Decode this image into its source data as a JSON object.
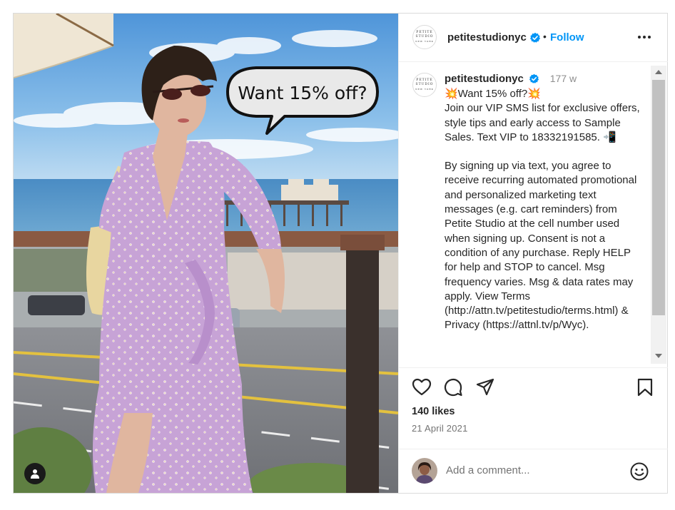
{
  "photo": {
    "bubble_text": "Want 15% off?",
    "user_tag_icon": "user-icon"
  },
  "header": {
    "avatar_lines": [
      "PETITE",
      "STUDIO",
      "NEW YORK"
    ],
    "username": "petitestudionyc",
    "verified_icon": "verified-badge-icon",
    "separator": "•",
    "follow_label": "Follow",
    "more_icon": "more-options-icon"
  },
  "caption": {
    "username": "petitestudionyc",
    "age": "177 w",
    "paragraph1": "💥Want 15% off?💥\nJoin our VIP SMS list for exclusive offers, style tips and early access to Sample Sales. Text VIP to 18332191585. 📲",
    "paragraph2": "By signing up via text, you agree to receive recurring automated promotional and personalized marketing text messages (e.g. cart reminders) from Petite Studio at the cell number used when signing up. Consent is not a condition of any purchase. Reply HELP for help and STOP to cancel. Msg frequency varies. Msg & data rates may apply. View Terms (http://attn.tv/petitestudio/terms.html) & Privacy (https://attnl.tv/p/Wyc)."
  },
  "actions": {
    "icons": [
      "heart-icon",
      "comment-icon",
      "share-icon",
      "bookmark-icon"
    ],
    "likes": "140 likes",
    "date": "21 April 2021"
  },
  "comment": {
    "placeholder": "Add a comment...",
    "emoji_icon": "emoji-icon"
  },
  "colors": {
    "accent": "#0095f6",
    "verified": "#0095f6",
    "dress": "#c9a6d8",
    "sky": "#5aa0dd"
  }
}
